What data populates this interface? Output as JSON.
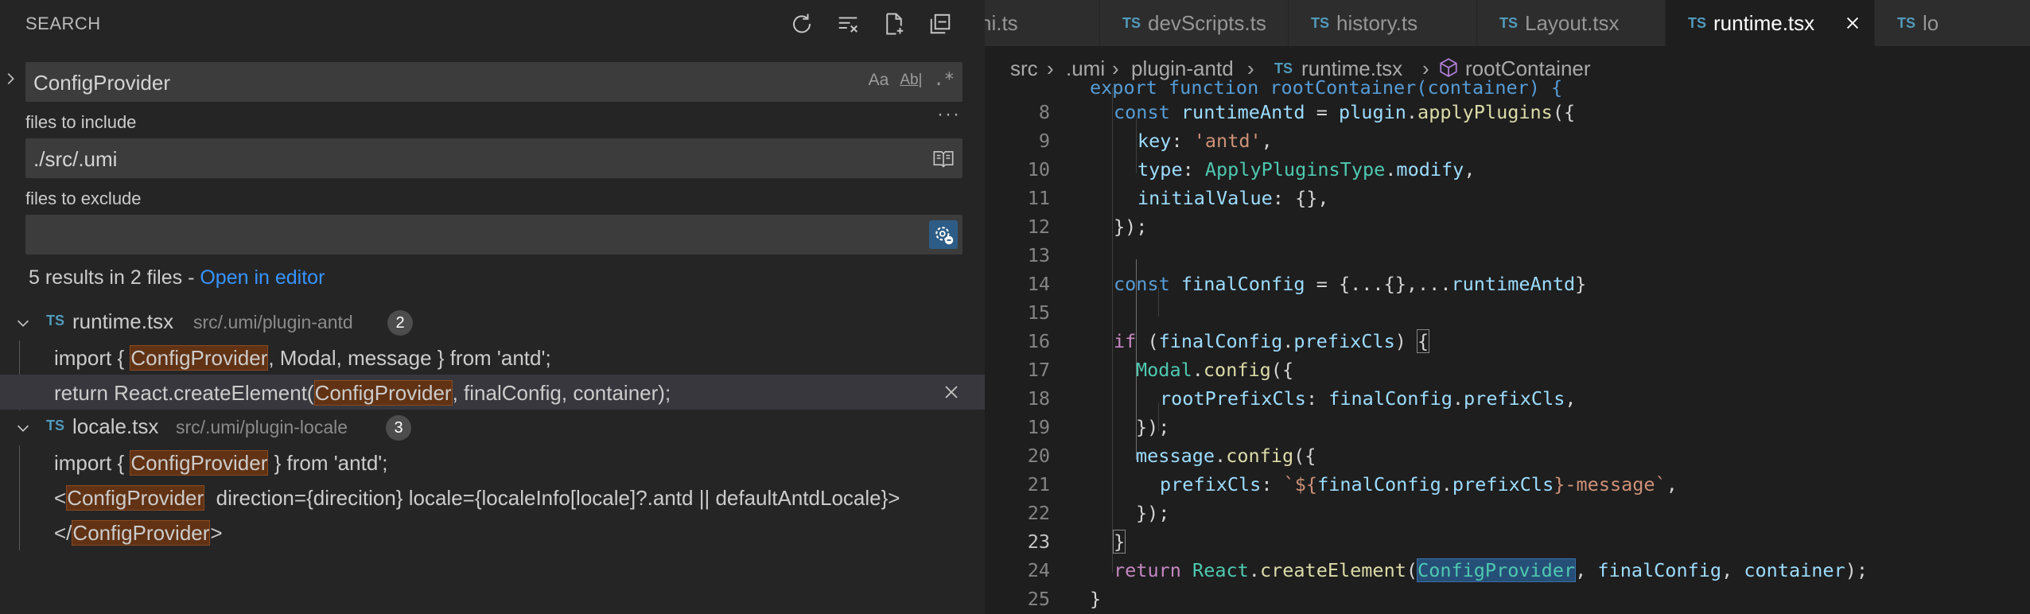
{
  "sidebar": {
    "title": "SEARCH",
    "actions": [
      {
        "name": "refresh-icon"
      },
      {
        "name": "clear-results-icon"
      },
      {
        "name": "new-search-editor-icon"
      },
      {
        "name": "collapse-all-icon"
      }
    ],
    "search": {
      "value": "ConfigProvider",
      "opt_case": "Aa",
      "opt_word": "Ab|",
      "opt_regex": ".*"
    },
    "more": "···",
    "include_label": "files to include",
    "include_value": "./src/.umi",
    "exclude_label": "files to exclude",
    "exclude_value": "",
    "summary": "5 results in 2 files - ",
    "summary_link": "Open in editor",
    "files": [
      {
        "icon": "TS",
        "name": "runtime.tsx",
        "path": "src/.umi/plugin-antd",
        "count": "2",
        "matches": [
          {
            "pre": "import { ",
            "match": "ConfigProvider",
            "post": ", Modal, message } from 'antd';"
          },
          {
            "pre": "return React.createElement(",
            "match": "ConfigProvider",
            "post": ", finalConfig, container);"
          }
        ]
      },
      {
        "icon": "TS",
        "name": "locale.tsx",
        "path": "src/.umi/plugin-locale",
        "count": "3",
        "matches": [
          {
            "pre": "import { ",
            "match": "ConfigProvider",
            "post": " } from 'antd';"
          },
          {
            "pre": "<",
            "match": "ConfigProvider",
            "post": "  direction={direcition} locale={localeInfo[locale]?.antd || defaultAntdLocale}>"
          },
          {
            "pre": "</",
            "match": "ConfigProvider",
            "post": ">"
          }
        ]
      }
    ]
  },
  "editor": {
    "tabs": [
      {
        "icon": "",
        "name": "ni.ts"
      },
      {
        "icon": "TS",
        "name": "devScripts.ts"
      },
      {
        "icon": "TS",
        "name": "history.ts"
      },
      {
        "icon": "TS",
        "name": "Layout.tsx"
      },
      {
        "icon": "TS",
        "name": "runtime.tsx"
      },
      {
        "icon": "TS",
        "name": "lo"
      }
    ],
    "breadcrumb": {
      "b1": "src",
      "b2": ".umi",
      "b3": "plugin-antd",
      "b4_icon": "TS",
      "b4": "runtime.tsx",
      "b5": "rootContainer"
    },
    "partial_line": "export function rootContainer(container) {",
    "line_numbers": [
      "8",
      "9",
      "10",
      "11",
      "12",
      "13",
      "14",
      "15",
      "16",
      "17",
      "18",
      "19",
      "20",
      "21",
      "22",
      "23",
      "24",
      "25"
    ],
    "code": {
      "l8_kw": "const",
      "l8_var": "runtimeAntd",
      "l8_eq": " = ",
      "l8_obj": "plugin",
      "l8_fn": "applyPlugins",
      "l8_end": "({",
      "l9_prop": "key",
      "l9_str": "'antd'",
      "l10_prop": "type",
      "l10_type": "ApplyPluginsType",
      "l10_prop2": "modify",
      "l11_prop": "initialValue",
      "l11_rest": ": {},",
      "l12": "});",
      "l14_kw": "const",
      "l14_var": "finalConfig",
      "l14_mid": " = {...{},...",
      "l14_var2": "runtimeAntd",
      "l14_end": "}",
      "l16_kw": "if",
      "l16_var": "finalConfig",
      "l16_prop": "prefixCls",
      "l17_type": "Modal",
      "l17_fn": "config",
      "l18_prop": "rootPrefixCls",
      "l18_var": "finalConfig",
      "l18_prop2": "prefixCls",
      "l19": "});",
      "l20_var": "message",
      "l20_fn": "config",
      "l21_prop": "prefixCls",
      "l21_tpl1": "`${",
      "l21_var": "finalConfig",
      "l21_prop2": "prefixCls",
      "l21_tpl2": "}-message`",
      "l22": "});",
      "l23": "}",
      "l24_kw": "return",
      "l24_type": "React",
      "l24_fn": "createElement",
      "l24_sel": "ConfigProvider",
      "l24_var": "finalConfig",
      "l24_var2": "container",
      "l25": "}"
    }
  },
  "colors": {
    "accent": "#3794ff",
    "match_highlight": "#613214",
    "ts_icon": "#519aba"
  }
}
